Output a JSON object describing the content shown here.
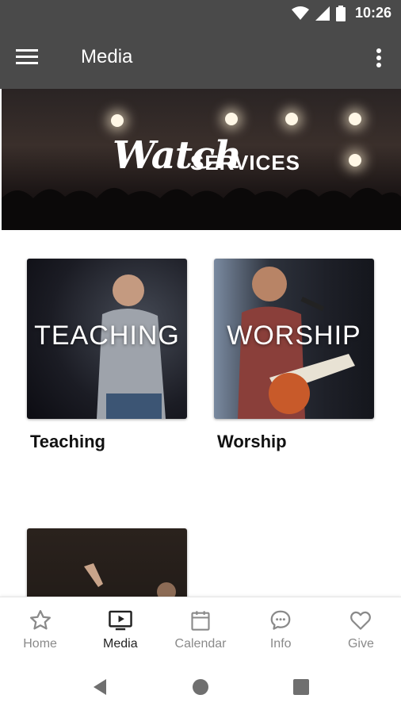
{
  "status": {
    "time": "10:26"
  },
  "appbar": {
    "title": "Media",
    "menu_icon": "hamburger-menu-icon",
    "more_icon": "more-vertical-icon"
  },
  "hero": {
    "title_script": "Watch",
    "title_caps": "SERVICES"
  },
  "cards": [
    {
      "overlay": "TEACHING",
      "label": "Teaching"
    },
    {
      "overlay": "WORSHIP",
      "label": "Worship"
    }
  ],
  "bottom_nav": [
    {
      "label": "Home",
      "icon": "star-icon"
    },
    {
      "label": "Media",
      "icon": "tv-play-icon",
      "active": true
    },
    {
      "label": "Calendar",
      "icon": "calendar-icon"
    },
    {
      "label": "Info",
      "icon": "chat-bubble-icon"
    },
    {
      "label": "Give",
      "icon": "heart-icon"
    }
  ],
  "colors": {
    "bar": "#4a4a4a",
    "active": "#222222",
    "inactive": "#8a8a8a"
  }
}
